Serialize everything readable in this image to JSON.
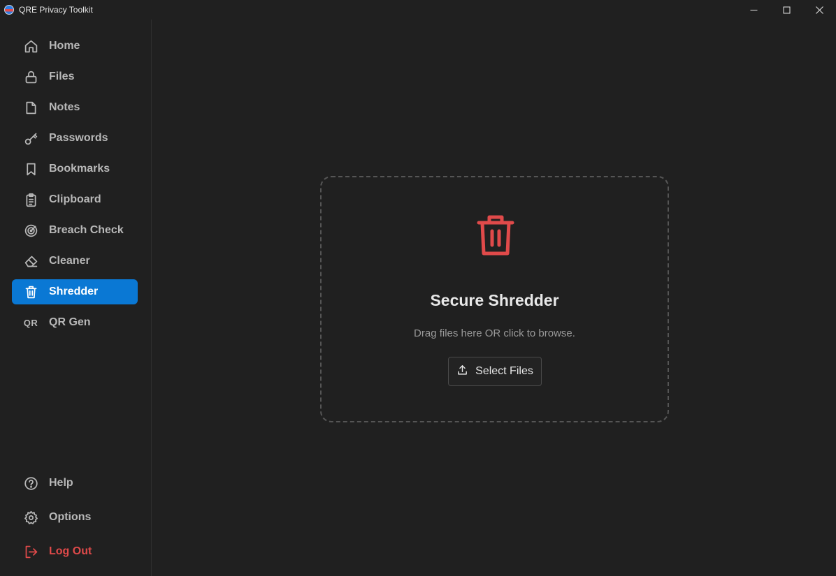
{
  "window": {
    "title": "QRE Privacy Toolkit",
    "controls": {
      "minimize": "minimize-icon",
      "maximize": "maximize-icon",
      "close": "close-icon"
    }
  },
  "sidebar": {
    "items": [
      {
        "label": "Home",
        "icon": "home-icon"
      },
      {
        "label": "Files",
        "icon": "lock-icon"
      },
      {
        "label": "Notes",
        "icon": "note-icon"
      },
      {
        "label": "Passwords",
        "icon": "key-icon"
      },
      {
        "label": "Bookmarks",
        "icon": "bookmark-icon"
      },
      {
        "label": "Clipboard",
        "icon": "clipboard-icon"
      },
      {
        "label": "Breach Check",
        "icon": "radar-icon"
      },
      {
        "label": "Cleaner",
        "icon": "eraser-icon"
      },
      {
        "label": "Shredder",
        "icon": "trash-icon",
        "active": true
      },
      {
        "label": "QR Gen",
        "icon": "qr-icon",
        "icon_text": "QR"
      }
    ],
    "bottom": [
      {
        "label": "Help",
        "icon": "help-icon"
      },
      {
        "label": "Options",
        "icon": "gear-icon"
      },
      {
        "label": "Log Out",
        "icon": "logout-icon"
      }
    ]
  },
  "shredder": {
    "title": "Secure Shredder",
    "subtitle": "Drag files here OR click to browse.",
    "select_button": "Select Files",
    "icon": "trash-icon"
  },
  "colors": {
    "background": "#202020",
    "accent": "#0a78d4",
    "danger": "#e04a4a",
    "text": "#b8b8b8"
  }
}
